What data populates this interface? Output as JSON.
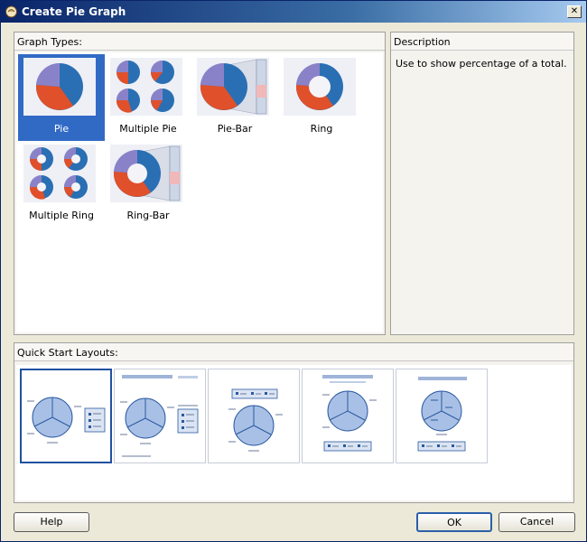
{
  "window": {
    "title": "Create Pie Graph",
    "close_glyph": "✕"
  },
  "graph_types": {
    "header_label": "Graph Types:",
    "items": [
      {
        "label": "Pie",
        "icon": "pie-icon",
        "selected": true
      },
      {
        "label": "Multiple Pie",
        "icon": "multiple-pie-icon",
        "selected": false
      },
      {
        "label": "Pie-Bar",
        "icon": "pie-bar-icon",
        "selected": false
      },
      {
        "label": "Ring",
        "icon": "ring-icon",
        "selected": false
      },
      {
        "label": "Multiple Ring",
        "icon": "multiple-ring-icon",
        "selected": false
      },
      {
        "label": "Ring-Bar",
        "icon": "ring-bar-icon",
        "selected": false
      }
    ]
  },
  "description": {
    "header_label": "Description",
    "text": "Use to show percentage of a total."
  },
  "quick_start": {
    "header_label": "Quick Start Layouts:",
    "layouts": [
      {
        "name": "layout-1",
        "selected": true
      },
      {
        "name": "layout-2",
        "selected": false
      },
      {
        "name": "layout-3",
        "selected": false
      },
      {
        "name": "layout-4",
        "selected": false
      },
      {
        "name": "layout-5",
        "selected": false
      }
    ]
  },
  "buttons": {
    "help": "Help",
    "ok": "OK",
    "cancel": "Cancel"
  },
  "colors": {
    "selection": "#316ac5",
    "pie_blue": "#2a6fb3",
    "pie_red": "#e0502a",
    "pie_purple": "#8a82c8",
    "thumb_blue": "#9fb8e0"
  }
}
